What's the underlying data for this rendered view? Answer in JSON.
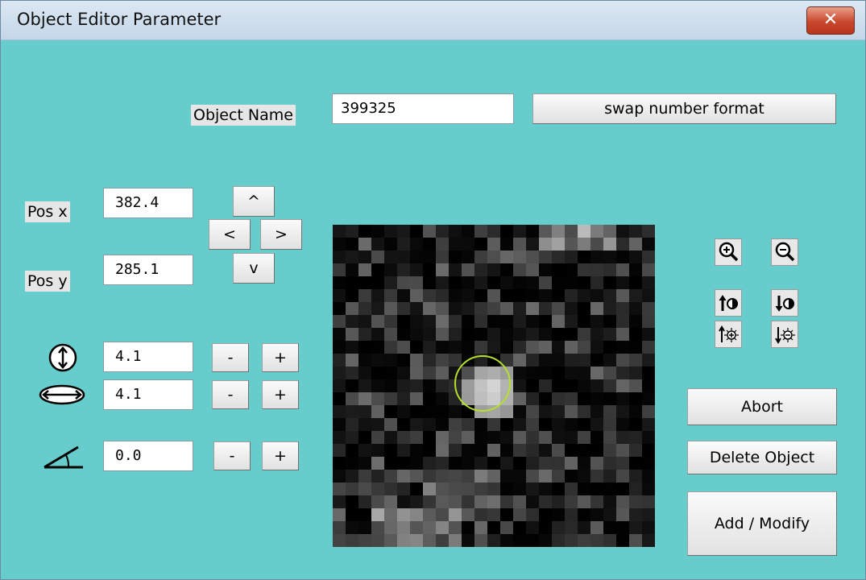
{
  "window": {
    "title": "Object Editor Parameter",
    "close_icon": "close-icon",
    "close_label": "✕"
  },
  "object_name": {
    "label": "Object Name",
    "value": "399325",
    "swap_label": "swap number format"
  },
  "position": {
    "x_label": "Pos x",
    "x_value": "382.4",
    "y_label": "Pos y",
    "y_value": "285.1",
    "up_label": "^",
    "left_label": "<",
    "right_label": ">",
    "down_label": "v"
  },
  "shape": {
    "height_icon": "vertical-extent-icon",
    "height_value": "4.1",
    "width_icon": "horizontal-extent-icon",
    "width_value": "4.1",
    "angle_icon": "angle-icon",
    "angle_value": "0.0",
    "minus_label": "-",
    "plus_label": "+"
  },
  "tools": {
    "icons": [
      "zoom-in-icon",
      "zoom-out-icon",
      "brightness-up-icon",
      "brightness-down-icon",
      "contrast-up-icon",
      "contrast-down-icon"
    ]
  },
  "actions": {
    "abort_label": "Abort",
    "delete_label": "Delete Object",
    "add_modify_label": "Add / Modify"
  },
  "colors": {
    "background": "#66cdcc",
    "marker": "#b6e02a",
    "close": "#c9472c"
  }
}
